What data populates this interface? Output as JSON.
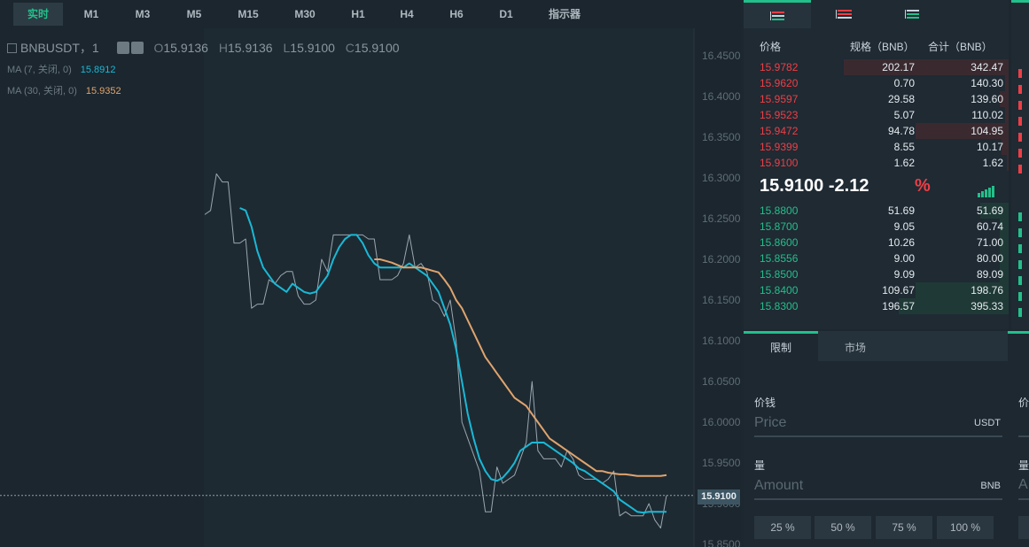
{
  "timeframes": [
    {
      "label": "实时",
      "active": true
    },
    {
      "label": "M1"
    },
    {
      "label": "M3"
    },
    {
      "label": "M5"
    },
    {
      "label": "M15"
    },
    {
      "label": "M30"
    },
    {
      "label": "H1"
    },
    {
      "label": "H4"
    },
    {
      "label": "H6"
    },
    {
      "label": "D1"
    },
    {
      "label": "指示器"
    }
  ],
  "hud": {
    "symbol": "BNBUSDT，1",
    "o_label": "O",
    "o": "15.9136",
    "h_label": "H",
    "h": "15.9136",
    "l_label": "L",
    "l": "15.9100",
    "c_label": "C",
    "c": "15.9100",
    "ma7_label": "MA (7, 关闭, 0)",
    "ma7_value": "15.8912",
    "ma30_label": "MA (30, 关闭, 0)",
    "ma30_value": "15.9352"
  },
  "chart_data": {
    "type": "line",
    "y_ticks": [
      "16.4500",
      "16.4000",
      "16.3500",
      "16.3000",
      "16.2500",
      "16.2000",
      "16.1500",
      "16.1000",
      "16.0500",
      "16.0000",
      "15.9500",
      "15.9000",
      "15.8500"
    ],
    "ylim": [
      15.845,
      16.47
    ],
    "current_price_label": "15.9100",
    "current_price": 15.91,
    "series": [
      {
        "name": "price",
        "color": "#9aa7b0",
        "values": [
          16.255,
          16.26,
          16.305,
          16.295,
          16.295,
          16.22,
          16.22,
          16.225,
          16.14,
          16.145,
          16.145,
          16.175,
          16.17,
          16.18,
          16.185,
          16.185,
          16.155,
          16.145,
          16.145,
          16.15,
          16.2,
          16.185,
          16.23,
          16.23,
          16.23,
          16.23,
          16.23,
          16.23,
          16.225,
          16.225,
          16.175,
          16.175,
          16.175,
          16.18,
          16.195,
          16.23,
          16.19,
          16.195,
          16.185,
          16.15,
          16.145,
          16.13,
          16.15,
          16.1,
          16.0,
          15.98,
          15.96,
          15.94,
          15.89,
          15.89,
          15.945,
          15.925,
          15.93,
          15.935,
          15.955,
          15.975,
          16.05,
          15.965,
          15.955,
          15.955,
          15.955,
          15.945,
          15.965,
          15.955,
          15.935,
          15.93,
          15.93,
          15.93,
          15.925,
          15.93,
          15.94,
          15.885,
          15.89,
          15.885,
          15.885,
          15.885,
          15.9,
          15.88,
          15.87,
          15.91
        ]
      },
      {
        "name": "MA7",
        "color": "#19b9d6",
        "values": [
          null,
          null,
          null,
          null,
          null,
          null,
          16.263,
          16.26,
          16.24,
          16.21,
          16.19,
          16.18,
          16.17,
          16.165,
          16.16,
          16.17,
          16.165,
          16.16,
          16.158,
          16.16,
          16.17,
          16.18,
          16.2,
          16.215,
          16.225,
          16.23,
          16.23,
          16.22,
          16.205,
          16.195,
          16.19,
          16.19,
          16.19,
          16.19,
          16.19,
          16.195,
          16.19,
          16.185,
          16.18,
          16.17,
          16.16,
          16.14,
          16.12,
          16.09,
          16.05,
          16.01,
          15.98,
          15.955,
          15.94,
          15.93,
          15.928,
          15.932,
          15.94,
          15.95,
          15.965,
          15.97,
          15.975,
          15.975,
          15.975,
          15.97,
          15.965,
          15.96,
          15.955,
          15.95,
          15.943,
          15.94,
          15.935,
          15.93,
          15.925,
          15.92,
          15.915,
          15.905,
          15.9,
          15.895,
          15.89,
          15.889,
          15.89,
          15.89,
          15.89,
          15.89
        ]
      },
      {
        "name": "MA30",
        "color": "#e0a46d",
        "values": [
          null,
          null,
          null,
          null,
          null,
          null,
          null,
          null,
          null,
          null,
          null,
          null,
          null,
          null,
          null,
          null,
          null,
          null,
          null,
          null,
          null,
          null,
          null,
          null,
          null,
          null,
          null,
          null,
          null,
          16.2,
          16.2,
          16.198,
          16.196,
          16.193,
          16.19,
          16.19,
          16.19,
          16.19,
          16.188,
          16.186,
          16.184,
          16.175,
          16.165,
          16.15,
          16.14,
          16.125,
          16.11,
          16.095,
          16.08,
          16.07,
          16.06,
          16.05,
          16.04,
          16.03,
          16.025,
          16.02,
          16.01,
          16.0,
          15.99,
          15.98,
          15.975,
          15.97,
          15.965,
          15.96,
          15.955,
          15.95,
          15.945,
          15.94,
          15.94,
          15.938,
          15.937,
          15.936,
          15.936,
          15.935,
          15.934,
          15.934,
          15.934,
          15.934,
          15.934,
          15.935
        ]
      }
    ]
  },
  "orderbook": {
    "tabs": [
      "both-icon",
      "sell-icon",
      "buy-icon"
    ],
    "headers": {
      "price": "价格",
      "amount": "规格（BNB）",
      "total": "合计（BNB）"
    },
    "asks": [
      {
        "price": "15.9782",
        "amount": "202.17",
        "total": "342.47",
        "depth": 0.98
      },
      {
        "price": "15.9620",
        "amount": "0.70",
        "total": "140.30",
        "depth": 0.02
      },
      {
        "price": "15.9597",
        "amount": "29.58",
        "total": "139.60",
        "depth": 0.05
      },
      {
        "price": "15.9523",
        "amount": "5.07",
        "total": "110.02",
        "depth": 0.02
      },
      {
        "price": "15.9472",
        "amount": "94.78",
        "total": "104.95",
        "depth": 0.55
      },
      {
        "price": "15.9399",
        "amount": "8.55",
        "total": "10.17",
        "depth": 0.04
      },
      {
        "price": "15.9100",
        "amount": "1.62",
        "total": "1.62",
        "depth": 0.01
      }
    ],
    "last_price": "15.9100",
    "last_change": "-2.12",
    "pct_symbol": "%",
    "bids": [
      {
        "price": "15.8800",
        "amount": "51.69",
        "total": "51.69",
        "depth": 0.17
      },
      {
        "price": "15.8700",
        "amount": "9.05",
        "total": "60.74",
        "depth": 0.05
      },
      {
        "price": "15.8600",
        "amount": "10.26",
        "total": "71.00",
        "depth": 0.05
      },
      {
        "price": "15.8556",
        "amount": "9.00",
        "total": "80.00",
        "depth": 0.05
      },
      {
        "price": "15.8500",
        "amount": "9.09",
        "total": "89.09",
        "depth": 0.05
      },
      {
        "price": "15.8400",
        "amount": "109.67",
        "total": "198.76",
        "depth": 0.55
      },
      {
        "price": "15.8300",
        "amount": "196.57",
        "total": "395.33",
        "depth": 0.65
      }
    ]
  },
  "trade": {
    "tabs": [
      {
        "label": "限制",
        "active": true
      },
      {
        "label": "市场"
      }
    ],
    "price_label": "价钱",
    "price_placeholder": "Price",
    "price_unit": "USDT",
    "amount_label": "量",
    "amount_placeholder": "Amount",
    "amount_unit": "BNB",
    "percent_buttons": [
      "25 %",
      "50 %",
      "75 %",
      "100 %"
    ],
    "cut_price_label": "价",
    "cut_amount_label": "量",
    "cut_amount_placeholder": "A"
  }
}
